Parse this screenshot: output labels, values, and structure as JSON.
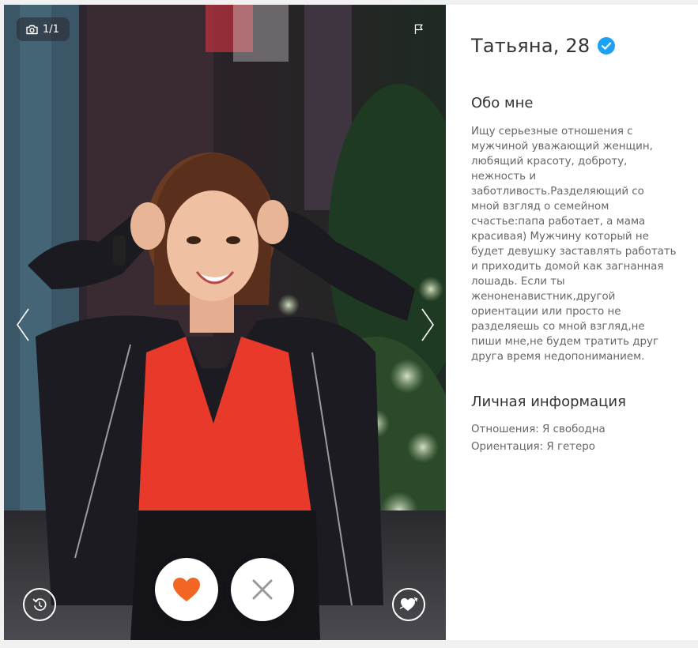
{
  "photo": {
    "counter": "1/1",
    "icons": {
      "camera": "camera-icon",
      "flag": "report-flag-icon",
      "prev": "chevron-left-icon",
      "next": "chevron-right-icon",
      "undo": "undo-icon",
      "like": "heart-icon",
      "dislike": "close-icon",
      "compliment": "heart-arrow-icon"
    },
    "colors": {
      "like": "#f26522",
      "dislike": "#9a9a9a"
    }
  },
  "profile": {
    "name_age": "Татьяна, 28",
    "verified_color": "#1da1f2",
    "about_title": "Обо мне",
    "about_text": "Ищу серьезные отношения с\nмужчиной уважающий женщин,\nлюбящий красоту, доброту,\nнежность и\nзаботливость.Разделяющий со\nмной взгляд о семейном\nсчастье:папа работает, а мама\nкрасивая) Мужчину который не\nбудет девушку заставлять работать\nи приходить домой как загнанная\nлошадь. Если ты\nженоненавистник,другой\nориентации или просто не\nразделяешь со мной взгляд,не\nпиши мне,не будем тратить друг\nдруга время недопониманием.",
    "personal_title": "Личная информация",
    "relationship": "Отношения: Я свободна",
    "orientation": "Ориентация: Я гетеро"
  }
}
